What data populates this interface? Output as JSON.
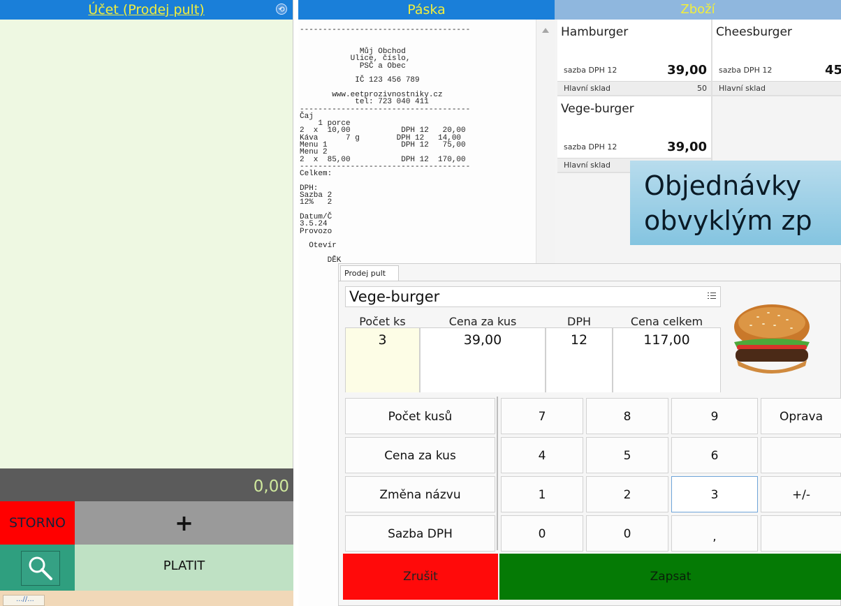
{
  "account": {
    "title": "Účet (Prodej pult)",
    "total": "0,00",
    "storno_label": "STORNO",
    "add_label": "+",
    "pay_label": "PLATIT",
    "mini_label": "...//..."
  },
  "receipt": {
    "title": "Páska",
    "lines": [
      "",
      "-------------------------------------",
      "",
      "",
      "             Můj Obchod",
      "           Ulice, číslo,",
      "             PSČ a Obec",
      "",
      "            IČ 123 456 789",
      "",
      "       www.eetprozivnostniky.cz",
      "            tel: 723 040 411",
      "-------------------------------------",
      "Čaj",
      "    1 porce",
      "2  x  10,00           DPH 12   20,00",
      "Káva      7 g        DPH 12   14,00",
      "Menu 1                DPH 12   75,00",
      "Menu 2",
      "2  x  85,00           DPH 12  170,00",
      "-------------------------------------",
      "Celkem:",
      "",
      "DPH:",
      "Sazba 2",
      "12%   2",
      "",
      "Datum/Č",
      "3.5.24",
      "Provozo",
      "",
      "  Otevír",
      "",
      "      DĚK"
    ]
  },
  "goods": {
    "title": "Zboží",
    "items": [
      {
        "name": "Hamburger",
        "vat": "sazba DPH  12",
        "price": "39,00",
        "store": "Hlavní sklad",
        "qty": "50"
      },
      {
        "name": "Cheesburger",
        "vat": "sazba DPH  12",
        "price": "45",
        "store": "Hlavní sklad",
        "qty": ""
      },
      {
        "name": "Vege-burger",
        "vat": "sazba DPH  12",
        "price": "39,00",
        "store": "Hlavní sklad",
        "qty": ""
      }
    ]
  },
  "banner": {
    "line1": "Objednávky",
    "line2": "obvyklým zp"
  },
  "dialog": {
    "tab": "Prodej pult",
    "item_name": "Vege-burger",
    "headers": {
      "qty": "Počet ks",
      "unit_price": "Cena za kus",
      "vat": "DPH",
      "total": "Cena celkem"
    },
    "values": {
      "qty": "3",
      "unit_price": "39,00",
      "vat": "12",
      "total": "117,00"
    },
    "keypad": {
      "functions": [
        "Počet kusů",
        "Cena za kus",
        "Změna názvu",
        "Sazba DPH"
      ],
      "rows": [
        [
          "7",
          "8",
          "9",
          "Oprava"
        ],
        [
          "4",
          "5",
          "6",
          ""
        ],
        [
          "1",
          "2",
          "3",
          "+/-"
        ],
        [
          "0",
          "0",
          ",",
          ""
        ]
      ]
    },
    "cancel_label": "Zrušit",
    "confirm_label": "Zapsat"
  },
  "colors": {
    "header_blue": "#1a7fd9",
    "header_text": "#f2ee3c",
    "storno_red": "#ff0000",
    "confirm_green": "#057a05",
    "pay_green": "#bfe1c4"
  }
}
